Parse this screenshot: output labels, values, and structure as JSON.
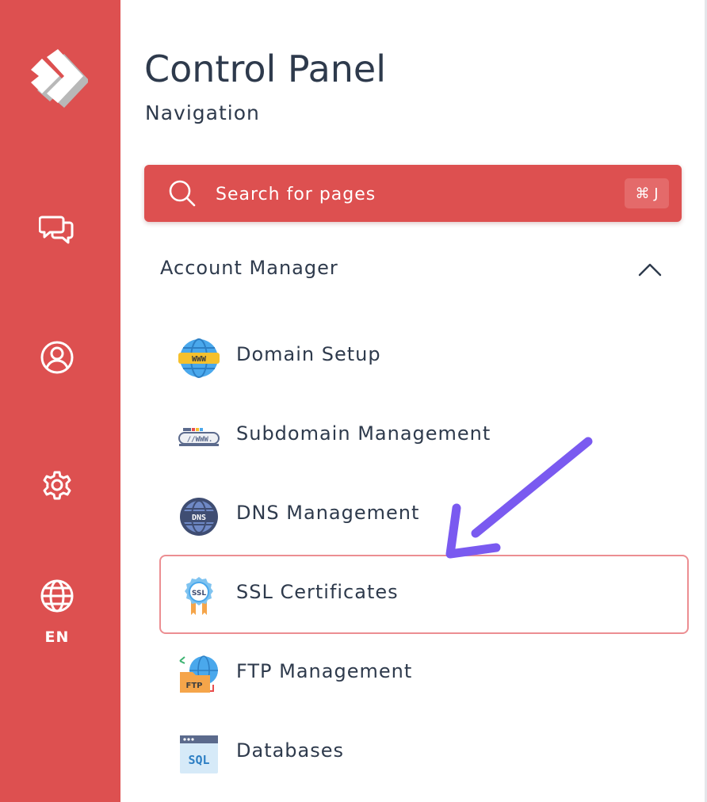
{
  "header": {
    "title": "Control Panel",
    "subtitle": "Navigation"
  },
  "search": {
    "placeholder": "Search for pages",
    "shortcut": "⌘ J"
  },
  "rail": {
    "items": [
      {
        "icon": "chat-icon"
      },
      {
        "icon": "user-profile-icon"
      },
      {
        "icon": "gear-icon"
      },
      {
        "icon": "globe-icon",
        "label": "EN"
      }
    ]
  },
  "section": {
    "label": "Account Manager",
    "expanded": true
  },
  "nav_items": [
    {
      "label": "Domain Setup",
      "icon": "www-globe-icon"
    },
    {
      "label": "Subdomain Management",
      "icon": "subdomain-icon"
    },
    {
      "label": "DNS Management",
      "icon": "dns-globe-icon"
    },
    {
      "label": "SSL Certificates",
      "icon": "ssl-badge-icon",
      "selected": true
    },
    {
      "label": "FTP Management",
      "icon": "ftp-folder-icon"
    },
    {
      "label": "Databases",
      "icon": "sql-database-icon"
    }
  ],
  "colors": {
    "brand": "#dd5050",
    "text": "#2e3a4c",
    "selected_border": "#ec8e92",
    "annotation_arrow": "#7a5af0"
  }
}
